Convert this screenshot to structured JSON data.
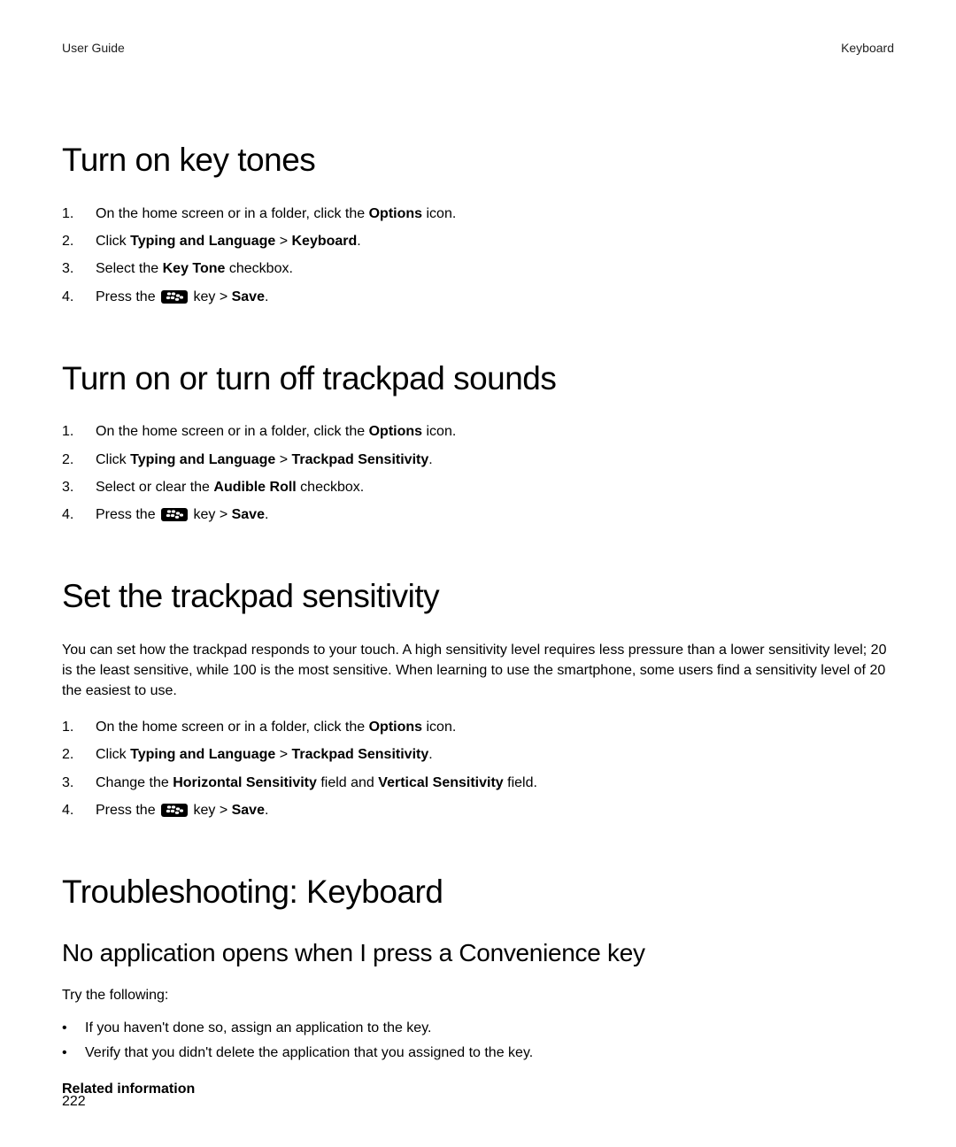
{
  "header": {
    "left": "User Guide",
    "right": "Keyboard"
  },
  "sections": {
    "s1": {
      "title": "Turn on key tones",
      "steps": {
        "a_pre": "On the home screen or in a folder, click the ",
        "a_bold": "Options",
        "a_post": " icon.",
        "b_pre": "Click ",
        "b_bold1": "Typing and Language",
        "b_sep": " > ",
        "b_bold2": "Keyboard",
        "b_post": ".",
        "c_pre": "Select the ",
        "c_bold": "Key Tone",
        "c_post": " checkbox.",
        "d_pre": "Press the ",
        "d_mid": " key > ",
        "d_bold": "Save",
        "d_post": "."
      }
    },
    "s2": {
      "title": "Turn on or turn off trackpad sounds",
      "steps": {
        "a_pre": "On the home screen or in a folder, click the ",
        "a_bold": "Options",
        "a_post": " icon.",
        "b_pre": "Click ",
        "b_bold1": "Typing and Language",
        "b_sep": " > ",
        "b_bold2": "Trackpad Sensitivity",
        "b_post": ".",
        "c_pre": "Select or clear the ",
        "c_bold": "Audible Roll",
        "c_post": " checkbox.",
        "d_pre": "Press the ",
        "d_mid": " key > ",
        "d_bold": "Save",
        "d_post": "."
      }
    },
    "s3": {
      "title": "Set the trackpad sensitivity",
      "intro": "You can set how the trackpad responds to your touch. A high sensitivity level requires less pressure than a lower sensitivity level; 20 is the least sensitive, while 100 is the most sensitive. When learning to use the smartphone, some users find a sensitivity level of 20 the easiest to use.",
      "steps": {
        "a_pre": "On the home screen or in a folder, click the ",
        "a_bold": "Options",
        "a_post": " icon.",
        "b_pre": "Click ",
        "b_bold1": "Typing and Language",
        "b_sep": " > ",
        "b_bold2": "Trackpad Sensitivity",
        "b_post": ".",
        "c_pre": "Change the ",
        "c_bold1": "Horizontal Sensitivity",
        "c_mid": " field and ",
        "c_bold2": "Vertical Sensitivity",
        "c_post": " field.",
        "d_pre": "Press the ",
        "d_mid": " key > ",
        "d_bold": "Save",
        "d_post": "."
      }
    },
    "s4": {
      "title": "Troubleshooting: Keyboard",
      "subtitle": "No application opens when I press a Convenience key",
      "try": "Try the following:",
      "bullets": {
        "a": "If you haven't done so, assign an application to the key.",
        "b": "Verify that you didn't delete the application that you assigned to the key."
      },
      "related": "Related information"
    }
  },
  "page_number": "222"
}
